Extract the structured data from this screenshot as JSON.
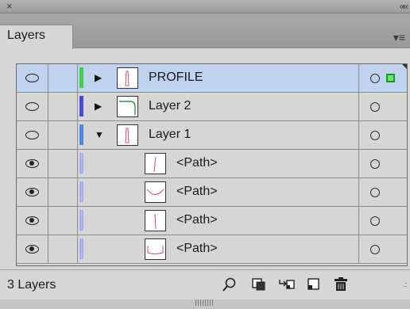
{
  "panel": {
    "close_glyph": "×",
    "collapse_glyph": "««",
    "tab_label": "Layers",
    "menu_glyph": "▾≡"
  },
  "layers": [
    {
      "name": "PROFILE",
      "expander": "▶",
      "visibility_icon": "eye-outline-icon",
      "color": "#3fd04a",
      "selected": true,
      "indent": 0
    },
    {
      "name": "Layer 2",
      "expander": "▶",
      "visibility_icon": "eye-outline-icon",
      "color": "#4a4ae0",
      "selected": false,
      "indent": 0
    },
    {
      "name": "Layer 1",
      "expander": "▼",
      "visibility_icon": "eye-outline-icon",
      "color": "#4a8ae6",
      "selected": false,
      "indent": 0
    },
    {
      "name": "<Path>",
      "expander": "",
      "visibility_icon": "eye-filled-icon",
      "color": "#aab0ee",
      "selected": false,
      "indent": 1
    },
    {
      "name": "<Path>",
      "expander": "",
      "visibility_icon": "eye-filled-icon",
      "color": "#aab0ee",
      "selected": false,
      "indent": 1
    },
    {
      "name": "<Path>",
      "expander": "",
      "visibility_icon": "eye-filled-icon",
      "color": "#aab0ee",
      "selected": false,
      "indent": 1
    },
    {
      "name": "<Path>",
      "expander": "",
      "visibility_icon": "eye-filled-icon",
      "color": "#aab0ee",
      "selected": false,
      "indent": 1
    }
  ],
  "footer": {
    "layer_count": "3 Layers",
    "tools": [
      "search-icon",
      "clipping-mask-icon",
      "new-sublayer-icon",
      "new-layer-icon",
      "trash-icon"
    ]
  },
  "colors": {
    "selection": "#bfd3ee",
    "panel_bg": "#d6d6d6",
    "selected_art_square": "#6fe36f"
  }
}
